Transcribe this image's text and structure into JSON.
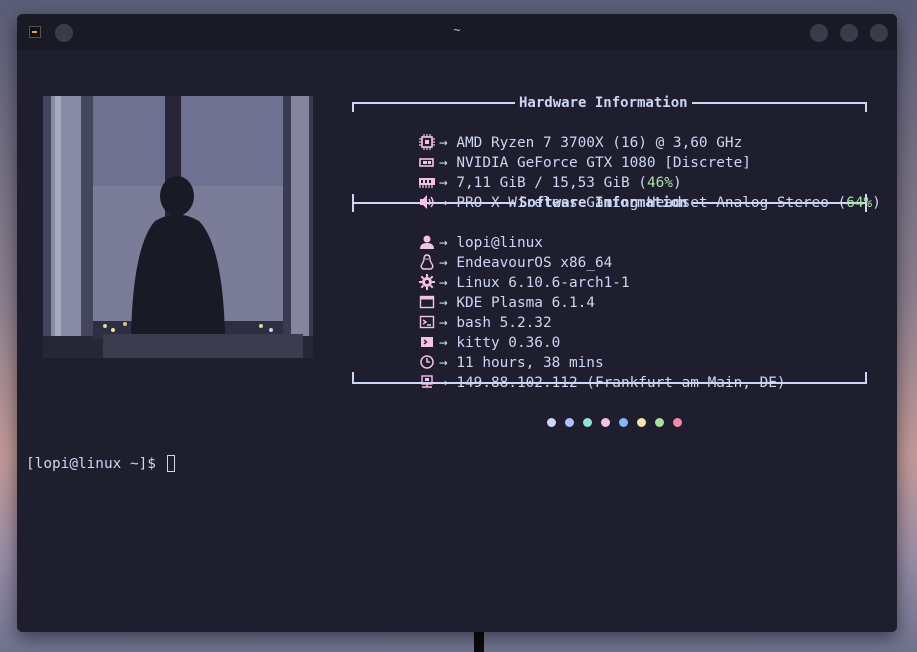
{
  "window": {
    "title": "~"
  },
  "hardware": {
    "header": "Hardware Information",
    "cpu": "AMD Ryzen 7 3700X (16) @ 3,60 GHz",
    "gpu": "NVIDIA GeForce GTX 1080 [Discrete]",
    "memory": "7,11 GiB / 15,53 GiB (",
    "memory_pct": "46%",
    "memory_close": ")",
    "audio": "PRO X Wireless Gaming Headset Analog Stereo (",
    "audio_pct": "64%",
    "audio_close": ")"
  },
  "software": {
    "header": "Software Information",
    "user": "lopi@linux",
    "os": "EndeavourOS x86_64",
    "kernel": "Linux 6.10.6-arch1-1",
    "de": "KDE Plasma 6.1.4",
    "shell": "bash 5.2.32",
    "terminal": "kitty 0.36.0",
    "uptime": "11 hours, 38 mins",
    "ip": "149.88.102.112 (Frankfurt am Main, DE)"
  },
  "arrow": "→",
  "palette": [
    "#cdd6f4",
    "#b4befe",
    "#94e2d5",
    "#f5c2e7",
    "#89b4fa",
    "#f9e2af",
    "#a6e3a1",
    "#f38ba8"
  ],
  "prompt": "[lopi@linux ~]$ "
}
